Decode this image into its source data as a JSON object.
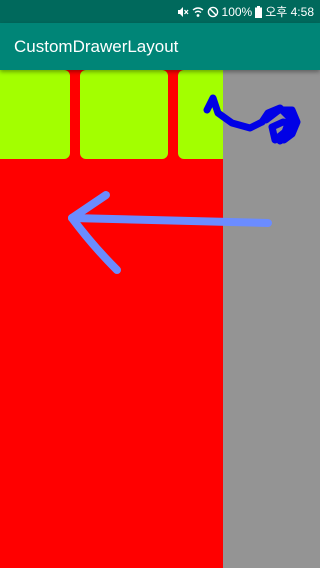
{
  "status_bar": {
    "battery_text": "100%",
    "time_text": "오후 4:58",
    "icons": [
      "mute-icon",
      "wifi-icon",
      "do-not-disturb-icon",
      "battery-icon"
    ]
  },
  "app_bar": {
    "title": "CustomDrawerLayout"
  },
  "colors": {
    "status_bar": "#00695c",
    "app_bar": "#008577",
    "drawer_panel": "#ff0000",
    "green_tile": "#a3ff00",
    "scrim": "#949494",
    "swipe_arrow": "#6b8cff",
    "gesture_scribble": "#0000e6"
  },
  "overlays": {
    "gesture_arrows": [
      "swipe-left-arrow",
      "touch-gesture-scribble"
    ]
  }
}
